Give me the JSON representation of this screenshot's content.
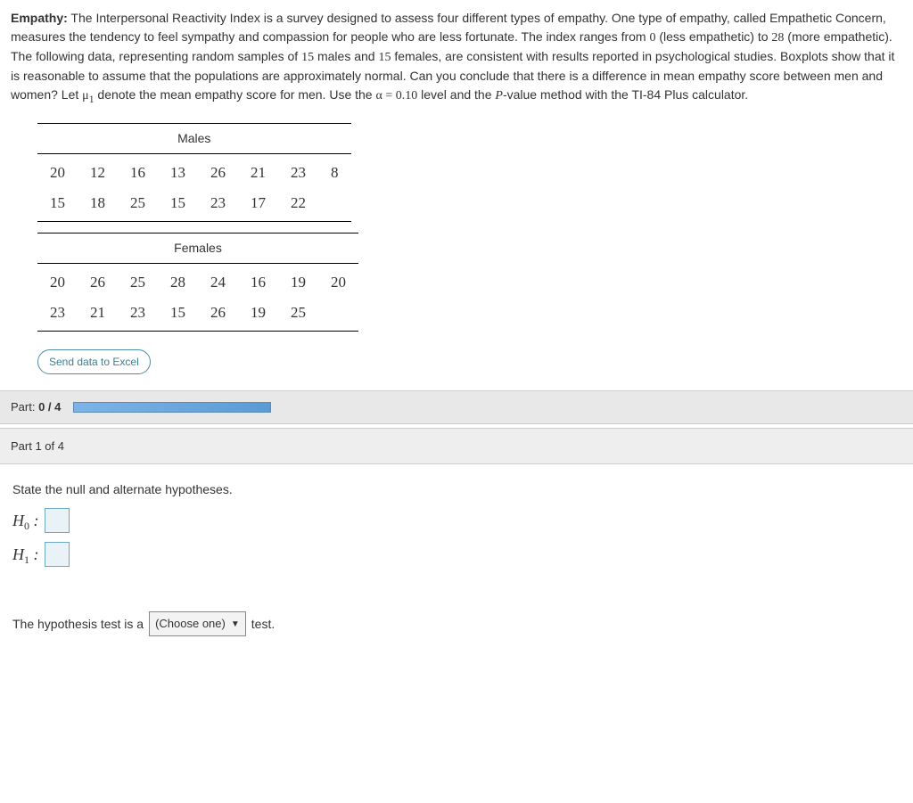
{
  "problem": {
    "title_bold": "Empathy:",
    "text_1": " The Interpersonal Reactivity Index is a survey designed to assess four different types of empathy. One type of empathy, called Empathetic Concern, measures the tendency to feel sympathy and compassion for people who are less fortunate. The index ranges from ",
    "val_low": "0",
    "text_2": " (less empathetic) to ",
    "val_high": "28",
    "text_3": " (more empathetic). The following data, representing random samples of ",
    "n_sample": "15",
    "text_4": " males and ",
    "n_sample2": "15",
    "text_5": " females, are consistent with results reported in psychological studies. Boxplots show that it is reasonable to assume that the populations are approximately normal. Can you conclude that there is a difference in mean empathy score between men and women? Let ",
    "mu_sym": "μ",
    "mu_sub": "1",
    "text_6": " denote the mean empathy score for men. Use the ",
    "alpha_sym": "α",
    "alpha_eq": " = ",
    "alpha_val": "0.10",
    "text_7": " level and the ",
    "pval_sym": "P",
    "text_8": "-value method with the TI-84 Plus calculator."
  },
  "tables": {
    "males_label": "Males",
    "males": [
      [
        "20",
        "12",
        "16",
        "13",
        "26",
        "21",
        "23",
        "8"
      ],
      [
        "15",
        "18",
        "25",
        "15",
        "23",
        "17",
        "22",
        ""
      ]
    ],
    "females_label": "Females",
    "females": [
      [
        "20",
        "26",
        "25",
        "28",
        "24",
        "16",
        "19",
        "20"
      ],
      [
        "23",
        "21",
        "23",
        "15",
        "26",
        "19",
        "25",
        ""
      ]
    ]
  },
  "buttons": {
    "excel": "Send data to Excel"
  },
  "progress": {
    "label_prefix": "Part: ",
    "done": "0",
    "sep": " / ",
    "total": "4"
  },
  "part_header": "Part 1 of 4",
  "question": {
    "prompt": "State the null and alternate hypotheses.",
    "h0_sym": "H",
    "h0_sub": "0",
    "colon": " :",
    "h1_sym": "H",
    "h1_sub": "1",
    "sentence_1": "The hypothesis test is a",
    "dropdown_placeholder": "(Choose one)",
    "sentence_2": "test."
  }
}
